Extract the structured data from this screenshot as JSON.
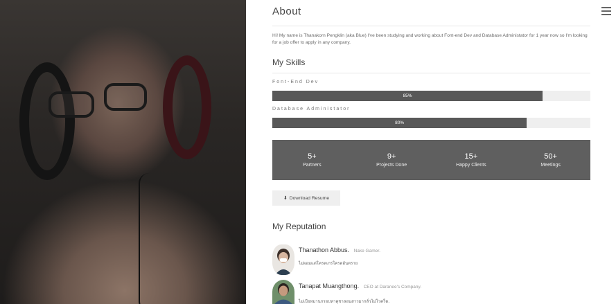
{
  "about": {
    "title": "About",
    "text": "Hi! My name is Thanakorn Pengklin (aka Blue) I've been studying and working about Font-end Dev and Database Administator for 1 year now so I'm looking for a job offer to apply in any company."
  },
  "skills": {
    "title": "My Skills",
    "items": [
      {
        "label": "Font-End Dev",
        "percent_label": "85%",
        "percent": 85
      },
      {
        "label": "Database Administator",
        "percent_label": "80%",
        "percent": 80
      }
    ]
  },
  "stats": [
    {
      "number": "5+",
      "label": "Partners"
    },
    {
      "number": "9+",
      "label": "Projects Done"
    },
    {
      "number": "15+",
      "label": "Happy Clients"
    },
    {
      "number": "50+",
      "label": "Meetings"
    }
  ],
  "download": {
    "label": "Download Resume",
    "icon": "download-icon"
  },
  "reputation": {
    "title": "My Reputation",
    "items": [
      {
        "name": "Thanathon Abbus.",
        "role": "Nake Gamer.",
        "quote": "ไม่ผอมแต่โครตเกรโครตอันตราย"
      },
      {
        "name": "Tanapat Muangthong.",
        "role": "CEO at Daranee's Company.",
        "quote": "ไม่เบียหมานกรอบหาคุชาลอนสาวมากลั่วไม่โวคร็ด."
      }
    ]
  },
  "colors": {
    "bar_fill": "#585858",
    "bar_track": "#efefef",
    "stats_bg": "#5f5f5f"
  },
  "menu": {
    "icon": "hamburger-menu-icon"
  }
}
